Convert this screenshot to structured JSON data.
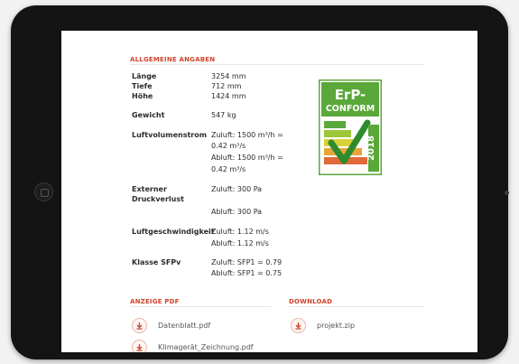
{
  "general": {
    "title": "ALLGEMEINE ANGABEN",
    "rows": [
      {
        "label": "Länge",
        "values": [
          "3254 mm"
        ]
      },
      {
        "label": "Tiefe",
        "values": [
          "712 mm"
        ]
      },
      {
        "label": "Höhe",
        "values": [
          "1424 mm"
        ]
      },
      {
        "label": "Gewicht",
        "values": [
          "547 kg"
        ]
      },
      {
        "label": "Luftvolumenstrom",
        "values": [
          "Zuluft: 1500 m³/h =",
          "0.42 m³/s",
          "Abluft: 1500 m³/h =",
          "0.42 m³/s"
        ]
      },
      {
        "label": "Externer",
        "label2": "Druckverlust",
        "values": [
          "Zuluft: 300 Pa",
          "Abluft: 300 Pa"
        ]
      },
      {
        "label": "Luftgeschwindigkeit",
        "values": [
          "Zuluft: 1.12 m/s",
          "Abluft: 1.12 m/s"
        ]
      },
      {
        "label": "Klasse SFPv",
        "values": [
          "Zuluft: SFP1 = 0.79",
          "Abluft: SFP1 = 0.75"
        ]
      }
    ]
  },
  "badge": {
    "line1": "ErP-",
    "line2": "CONFORM",
    "year": "2018",
    "colors": {
      "green": "#5aa83a",
      "check": "#2e8b2e",
      "bar_yellow": "#d9d13a",
      "bar_orange": "#e8a53a"
    }
  },
  "pdf": {
    "title": "ANZEIGE PDF",
    "files": [
      "Datenblatt.pdf",
      "Klimagerät_Zeichnung.pdf"
    ]
  },
  "download": {
    "title": "DOWNLOAD",
    "files": [
      "projekt.zip"
    ]
  },
  "icons": {
    "file": "download-arrow-icon"
  },
  "colors": {
    "accent": "#d0432b",
    "bezel": "#141414"
  }
}
